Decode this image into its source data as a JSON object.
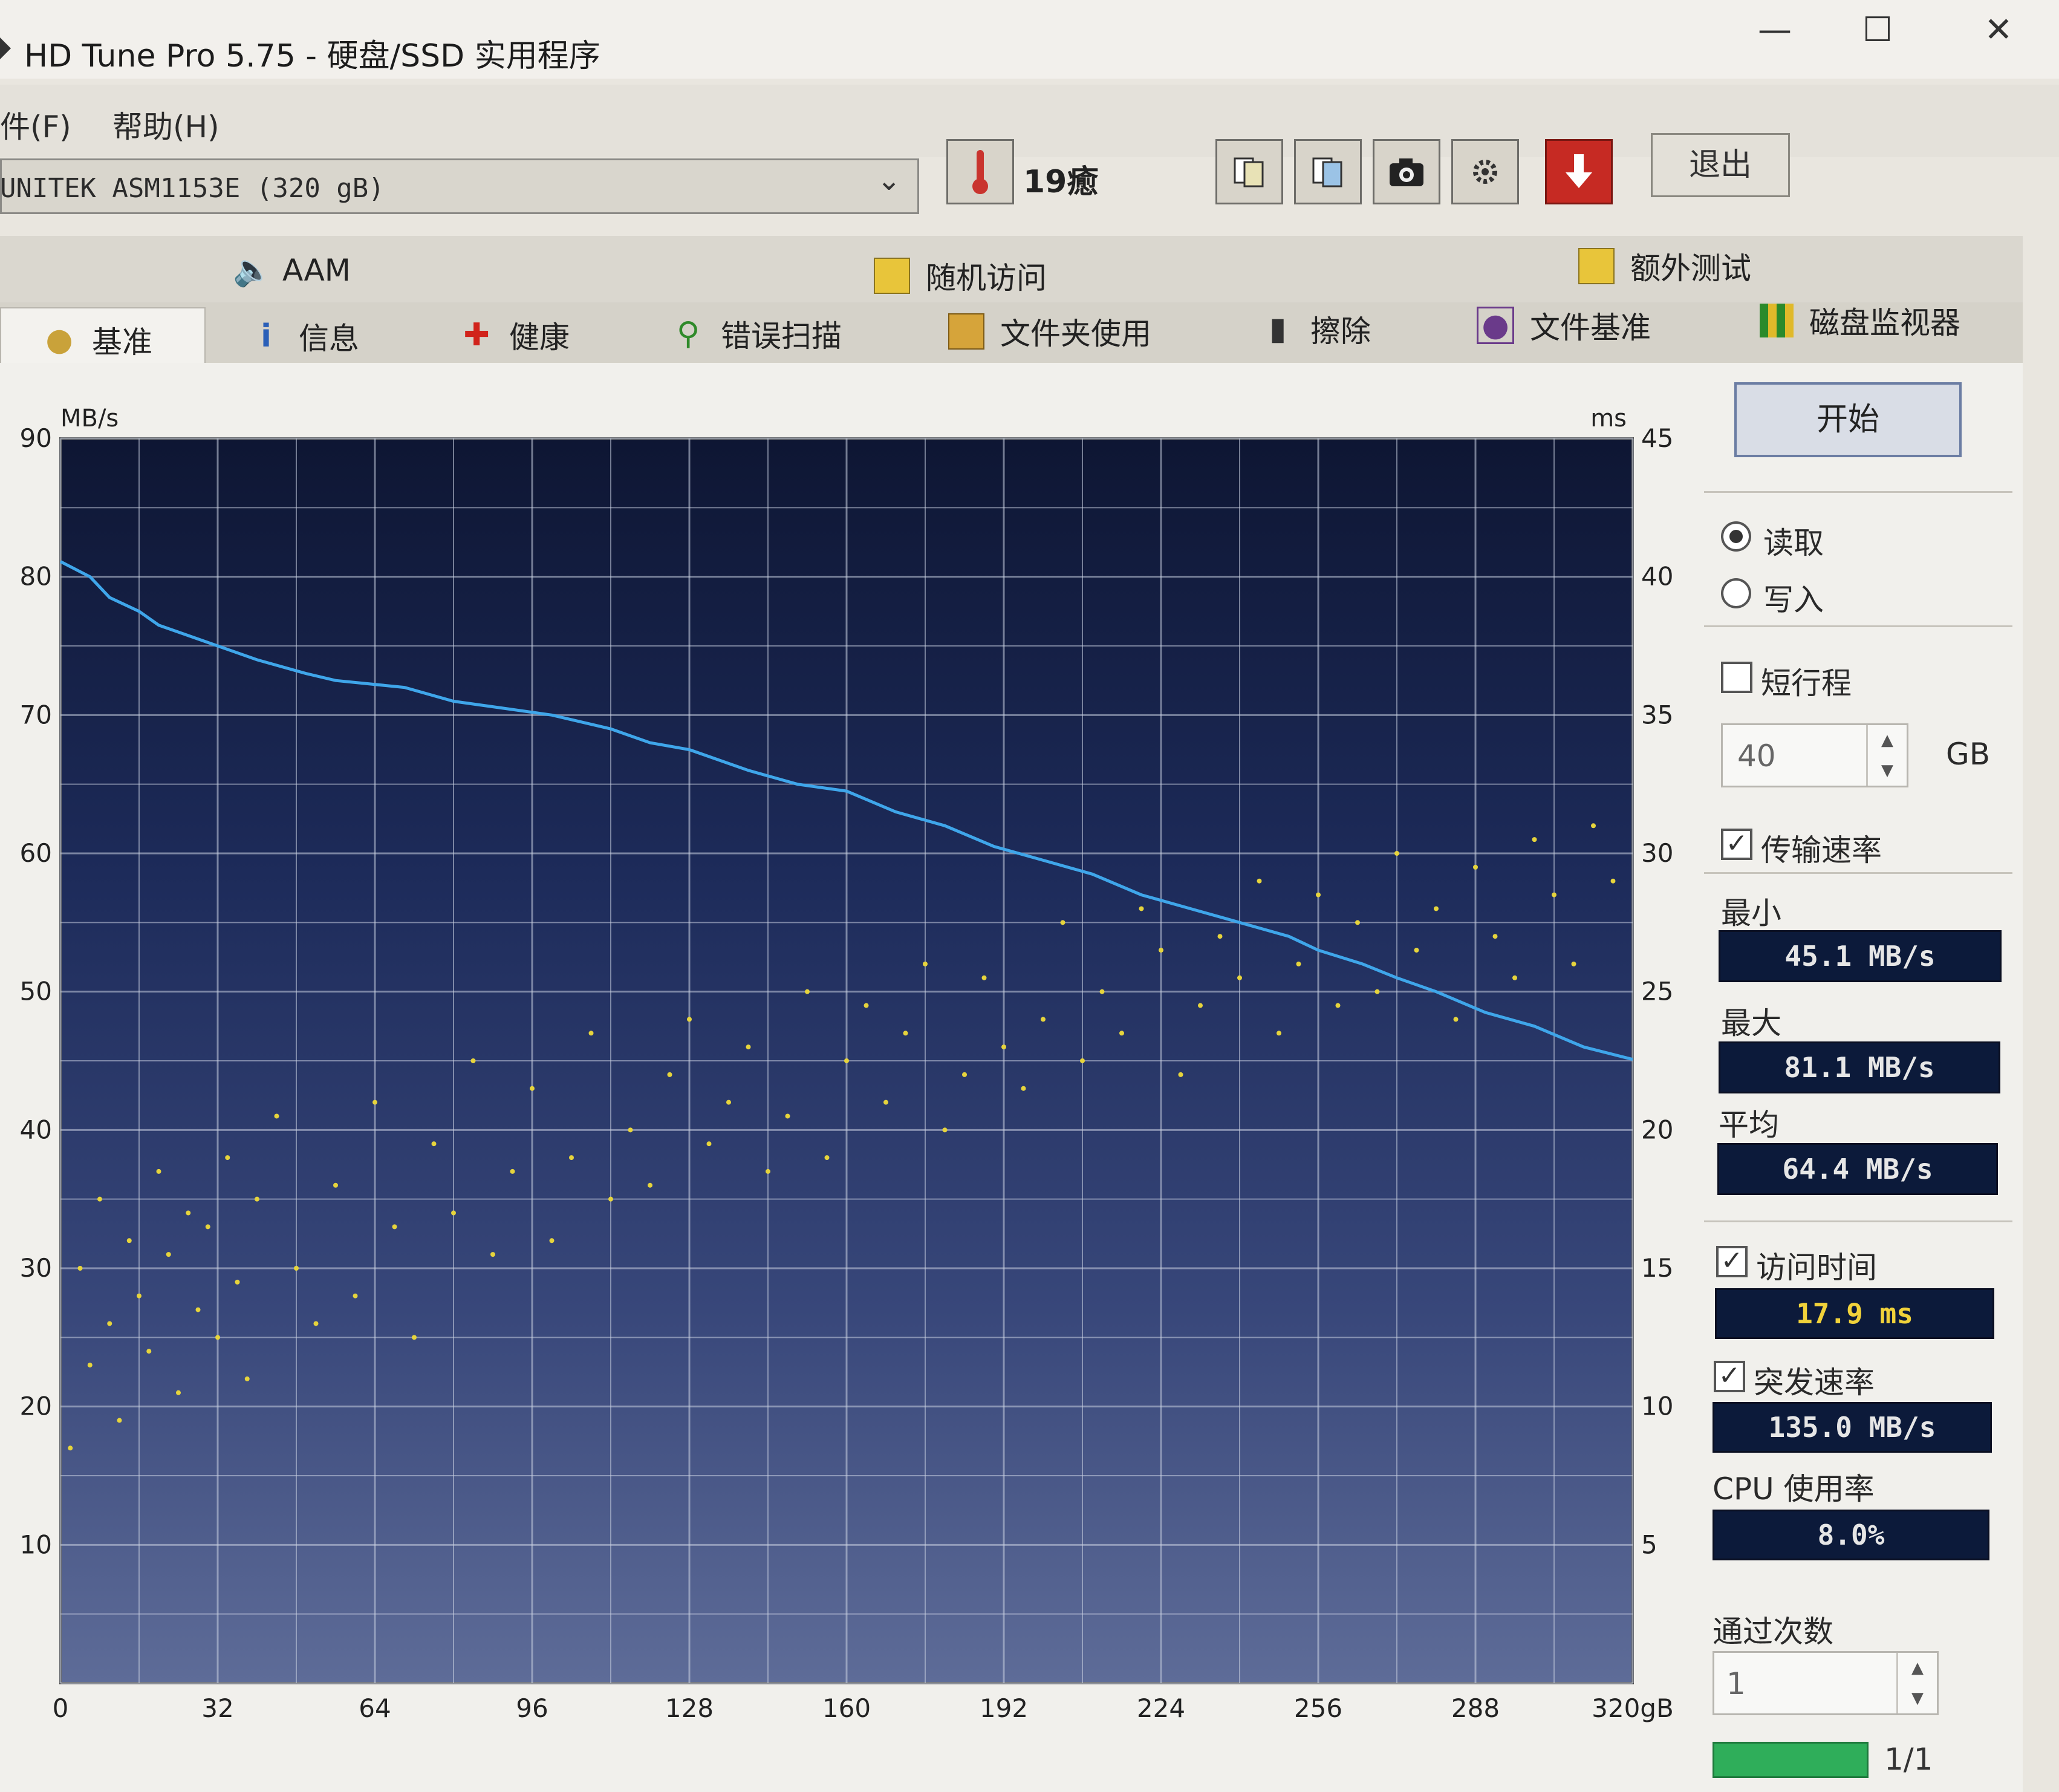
{
  "window": {
    "title": "HD Tune Pro 5.75 - 硬盘/SSD 实用程序",
    "minimize_icon": "minimize-icon",
    "maximize_icon": "maximize-icon",
    "close_icon": "close-icon"
  },
  "menu": {
    "file": "件(F)",
    "help": "帮助(H)"
  },
  "toolbar": {
    "drive": "UNITEK  ASM1153E (320 gB)",
    "temperature": "19癒",
    "icons": [
      "thermometer-icon",
      "copy-info-icon",
      "copy-screen-icon",
      "camera-icon",
      "options-icon",
      "save-icon"
    ],
    "exit": "退出"
  },
  "tabs": {
    "back": [
      {
        "label": "AAM",
        "icon": "speaker-icon"
      },
      {
        "label": "随机访问",
        "icon": "random-access-icon"
      },
      {
        "label": "额外测试",
        "icon": "extra-tests-icon"
      }
    ],
    "front": [
      {
        "label": "基准",
        "icon": "benchmark-icon"
      },
      {
        "label": "信息",
        "icon": "info-icon"
      },
      {
        "label": "健康",
        "icon": "health-icon"
      },
      {
        "label": "错误扫描",
        "icon": "magnifier-icon"
      },
      {
        "label": "文件夹使用",
        "icon": "folder-icon"
      },
      {
        "label": "擦除",
        "icon": "trash-icon"
      },
      {
        "label": "文件基准",
        "icon": "file-benchmark-icon"
      },
      {
        "label": "磁盘监视器",
        "icon": "disk-monitor-icon"
      }
    ]
  },
  "panel": {
    "start": "开始",
    "read": "读取",
    "write": "写入",
    "mode": "read",
    "short_stroke": "短行程",
    "short_stroke_checked": false,
    "stroke_value": "40",
    "stroke_unit": "GB",
    "transfer_rate": "传输速率",
    "transfer_rate_checked": true,
    "min_label": "最小",
    "min_value": "45.1 MB/s",
    "max_label": "最大",
    "max_value": "81.1 MB/s",
    "avg_label": "平均",
    "avg_value": "64.4 MB/s",
    "access_time": "访问时间",
    "access_time_checked": true,
    "access_value": "17.9 ms",
    "burst_rate": "突发速率",
    "burst_rate_checked": true,
    "burst_value": "135.0 MB/s",
    "cpu_label": "CPU 使用率",
    "cpu_value": "8.0%",
    "passes_label": "通过次数",
    "passes_value": "1",
    "progress_fraction": 1.0,
    "progress_text": "1/1"
  },
  "chart_data": {
    "type": "line",
    "left_unit": "MB/s",
    "right_unit": "ms",
    "x_ticks": [
      "0",
      "32",
      "64",
      "96",
      "128",
      "160",
      "192",
      "224",
      "256",
      "288",
      "320gB"
    ],
    "y_left_ticks": [
      "10",
      "20",
      "30",
      "40",
      "50",
      "60",
      "70",
      "80",
      "90"
    ],
    "y_right_ticks": [
      "5",
      "10",
      "15",
      "20",
      "25",
      "30",
      "35",
      "40",
      "45"
    ],
    "xlim": [
      0,
      320
    ],
    "ylim_left": [
      0,
      90
    ],
    "ylim_right": [
      0,
      45
    ],
    "grid": true,
    "colors": {
      "background": "#1b2a55",
      "line": "#3fa6ea",
      "dots": "#e6d43c",
      "grid": "#c8cfe0"
    },
    "series": [
      {
        "name": "传输速率",
        "axis": "left",
        "x": [
          0,
          6,
          10,
          16,
          20,
          24,
          32,
          40,
          50,
          56,
          70,
          80,
          90,
          100,
          112,
          120,
          128,
          140,
          150,
          160,
          170,
          180,
          190,
          200,
          210,
          220,
          230,
          240,
          250,
          256,
          265,
          272,
          280,
          290,
          300,
          310,
          320
        ],
        "values": [
          81.1,
          80.0,
          78.5,
          77.5,
          76.5,
          76.0,
          75.0,
          74.0,
          73.0,
          72.5,
          72.0,
          71.0,
          70.5,
          70.0,
          69.0,
          68.0,
          67.5,
          66.0,
          65.0,
          64.5,
          63.0,
          62.0,
          60.5,
          59.5,
          58.5,
          57.0,
          56.0,
          55.0,
          54.0,
          53.0,
          52.0,
          51.0,
          50.0,
          48.5,
          47.5,
          46.0,
          45.1
        ]
      },
      {
        "name": "访问时间",
        "axis": "right",
        "type": "scatter",
        "x": [
          2,
          4,
          6,
          8,
          10,
          12,
          14,
          16,
          18,
          20,
          22,
          24,
          26,
          28,
          30,
          32,
          34,
          36,
          38,
          40,
          44,
          48,
          52,
          56,
          60,
          64,
          68,
          72,
          76,
          80,
          84,
          88,
          92,
          96,
          100,
          104,
          108,
          112,
          116,
          120,
          124,
          128,
          132,
          136,
          140,
          144,
          148,
          152,
          156,
          160,
          164,
          168,
          172,
          176,
          180,
          184,
          188,
          192,
          196,
          200,
          204,
          208,
          212,
          216,
          220,
          224,
          228,
          232,
          236,
          240,
          244,
          248,
          252,
          256,
          260,
          264,
          268,
          272,
          276,
          280,
          284,
          288,
          292,
          296,
          300,
          304,
          308,
          312,
          316
        ],
        "values": [
          8.5,
          15.0,
          11.5,
          17.5,
          13.0,
          9.5,
          16.0,
          14.0,
          12.0,
          18.5,
          15.5,
          10.5,
          17.0,
          13.5,
          16.5,
          12.5,
          19.0,
          14.5,
          11.0,
          17.5,
          20.5,
          15.0,
          13.0,
          18.0,
          14.0,
          21.0,
          16.5,
          12.5,
          19.5,
          17.0,
          22.5,
          15.5,
          18.5,
          21.5,
          16.0,
          19.0,
          23.5,
          17.5,
          20.0,
          18.0,
          22.0,
          24.0,
          19.5,
          21.0,
          23.0,
          18.5,
          20.5,
          25.0,
          19.0,
          22.5,
          24.5,
          21.0,
          23.5,
          26.0,
          20.0,
          22.0,
          25.5,
          23.0,
          21.5,
          24.0,
          27.5,
          22.5,
          25.0,
          23.5,
          28.0,
          26.5,
          22.0,
          24.5,
          27.0,
          25.5,
          29.0,
          23.5,
          26.0,
          28.5,
          24.5,
          27.5,
          25.0,
          30.0,
          26.5,
          28.0,
          24.0,
          29.5,
          27.0,
          25.5,
          30.5,
          28.5,
          26.0,
          31.0,
          29.0
        ]
      }
    ]
  }
}
